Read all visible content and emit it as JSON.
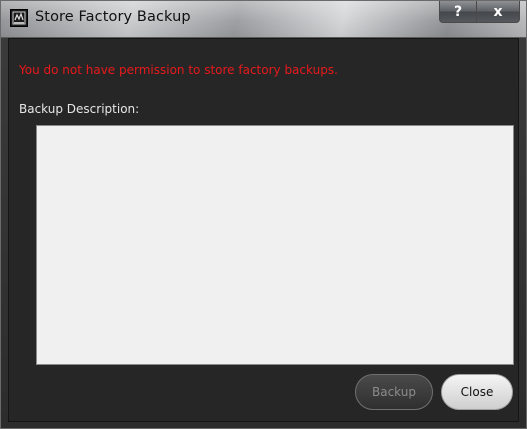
{
  "window": {
    "title": "Store Factory Backup",
    "app_icon": "app-logo-icon",
    "help_button_label": "?",
    "close_button_label": "x"
  },
  "dialog": {
    "error_message": "You do not have permission to store factory backups.",
    "description_label": "Backup Description:",
    "description_value": "",
    "backup_button_label": "Backup",
    "close_button_label": "Close"
  },
  "colors": {
    "error_text": "#e8191b",
    "dialog_background": "#262626",
    "text_area_background": "#f0f0f0"
  }
}
